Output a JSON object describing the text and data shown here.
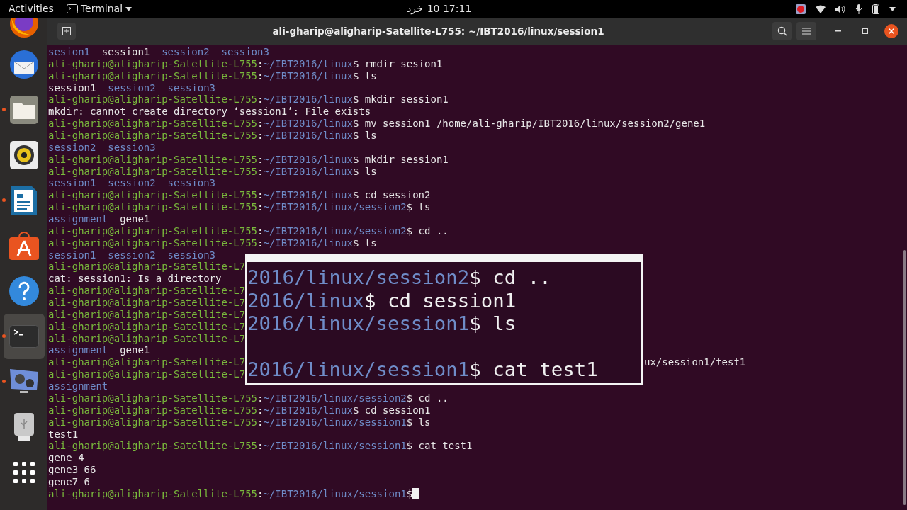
{
  "top_bar": {
    "activities": "Activities",
    "app_menu": "Terminal",
    "clock_label": "خرد",
    "clock_time": "10 17:11"
  },
  "dock": [
    {
      "kind": "firefox",
      "running": false,
      "selected": false
    },
    {
      "kind": "mail",
      "running": false,
      "selected": false
    },
    {
      "kind": "files",
      "running": true,
      "selected": false
    },
    {
      "kind": "music",
      "running": false,
      "selected": false
    },
    {
      "kind": "document",
      "running": true,
      "selected": false
    },
    {
      "kind": "store",
      "running": false,
      "selected": false
    },
    {
      "kind": "help",
      "running": false,
      "selected": false
    },
    {
      "kind": "terminal",
      "running": true,
      "selected": true
    },
    {
      "kind": "video",
      "running": true,
      "selected": false
    },
    {
      "kind": "usb",
      "running": false,
      "selected": false
    },
    {
      "kind": "apps",
      "running": false,
      "selected": false
    }
  ],
  "window": {
    "title": "ali-gharip@aligharip-Satellite-L755: ~/IBT2016/linux/session1"
  },
  "terminal": {
    "lines": [
      {
        "segments": [
          {
            "t": "sesion1",
            "kind": "dir"
          },
          {
            "t": "  session1  ",
            "kind": "plain"
          },
          {
            "t": "session2  ",
            "kind": "dir"
          },
          {
            "t": "session3",
            "kind": "dir"
          }
        ]
      },
      {
        "segments": [
          {
            "t": "ali-gharip@aligharip-Satellite-L755",
            "kind": "user"
          },
          {
            "t": ":",
            "kind": "plain"
          },
          {
            "t": "~/IBT2016/linux",
            "kind": "dir"
          },
          {
            "t": "$ rmdir sesion1",
            "kind": "plain"
          }
        ]
      },
      {
        "segments": [
          {
            "t": "ali-gharip@aligharip-Satellite-L755",
            "kind": "user"
          },
          {
            "t": ":",
            "kind": "plain"
          },
          {
            "t": "~/IBT2016/linux",
            "kind": "dir"
          },
          {
            "t": "$ ls",
            "kind": "plain"
          }
        ]
      },
      {
        "segments": [
          {
            "t": "session1  ",
            "kind": "plain"
          },
          {
            "t": "session2  ",
            "kind": "dir"
          },
          {
            "t": "session3",
            "kind": "dir"
          }
        ]
      },
      {
        "segments": [
          {
            "t": "ali-gharip@aligharip-Satellite-L755",
            "kind": "user"
          },
          {
            "t": ":",
            "kind": "plain"
          },
          {
            "t": "~/IBT2016/linux",
            "kind": "dir"
          },
          {
            "t": "$ mkdir session1",
            "kind": "plain"
          }
        ]
      },
      {
        "segments": [
          {
            "t": "mkdir: cannot create directory ‘session1’: File exists",
            "kind": "plain"
          }
        ]
      },
      {
        "segments": [
          {
            "t": "ali-gharip@aligharip-Satellite-L755",
            "kind": "user"
          },
          {
            "t": ":",
            "kind": "plain"
          },
          {
            "t": "~/IBT2016/linux",
            "kind": "dir"
          },
          {
            "t": "$ mv session1 /home/ali-gharip/IBT2016/linux/session2/gene1",
            "kind": "plain"
          }
        ]
      },
      {
        "segments": [
          {
            "t": "ali-gharip@aligharip-Satellite-L755",
            "kind": "user"
          },
          {
            "t": ":",
            "kind": "plain"
          },
          {
            "t": "~/IBT2016/linux",
            "kind": "dir"
          },
          {
            "t": "$ ls",
            "kind": "plain"
          }
        ]
      },
      {
        "segments": [
          {
            "t": "session2  ",
            "kind": "dir"
          },
          {
            "t": "session3",
            "kind": "dir"
          }
        ]
      },
      {
        "segments": [
          {
            "t": "ali-gharip@aligharip-Satellite-L755",
            "kind": "user"
          },
          {
            "t": ":",
            "kind": "plain"
          },
          {
            "t": "~/IBT2016/linux",
            "kind": "dir"
          },
          {
            "t": "$ mkdir session1",
            "kind": "plain"
          }
        ]
      },
      {
        "segments": [
          {
            "t": "ali-gharip@aligharip-Satellite-L755",
            "kind": "user"
          },
          {
            "t": ":",
            "kind": "plain"
          },
          {
            "t": "~/IBT2016/linux",
            "kind": "dir"
          },
          {
            "t": "$ ls",
            "kind": "plain"
          }
        ]
      },
      {
        "segments": [
          {
            "t": "session1  ",
            "kind": "dir"
          },
          {
            "t": "session2  ",
            "kind": "dir"
          },
          {
            "t": "session3",
            "kind": "dir"
          }
        ]
      },
      {
        "segments": [
          {
            "t": "ali-gharip@aligharip-Satellite-L755",
            "kind": "user"
          },
          {
            "t": ":",
            "kind": "plain"
          },
          {
            "t": "~/IBT2016/linux",
            "kind": "dir"
          },
          {
            "t": "$ cd session2",
            "kind": "plain"
          }
        ]
      },
      {
        "segments": [
          {
            "t": "ali-gharip@aligharip-Satellite-L755",
            "kind": "user"
          },
          {
            "t": ":",
            "kind": "plain"
          },
          {
            "t": "~/IBT2016/linux/session2",
            "kind": "dir"
          },
          {
            "t": "$ ls",
            "kind": "plain"
          }
        ]
      },
      {
        "segments": [
          {
            "t": "assignment",
            "kind": "dir"
          },
          {
            "t": "  gene1",
            "kind": "plain"
          }
        ]
      },
      {
        "segments": [
          {
            "t": "ali-gharip@aligharip-Satellite-L755",
            "kind": "user"
          },
          {
            "t": ":",
            "kind": "plain"
          },
          {
            "t": "~/IBT2016/linux/session2",
            "kind": "dir"
          },
          {
            "t": "$ cd ..",
            "kind": "plain"
          }
        ]
      },
      {
        "segments": [
          {
            "t": "ali-gharip@aligharip-Satellite-L755",
            "kind": "user"
          },
          {
            "t": ":",
            "kind": "plain"
          },
          {
            "t": "~/IBT2016/linux",
            "kind": "dir"
          },
          {
            "t": "$ ls",
            "kind": "plain"
          }
        ]
      },
      {
        "segments": [
          {
            "t": "session1  ",
            "kind": "dir"
          },
          {
            "t": "session2  ",
            "kind": "dir"
          },
          {
            "t": "session3",
            "kind": "dir"
          }
        ]
      },
      {
        "segments": [
          {
            "t": "ali-gharip@aligharip-Satellite-L7",
            "kind": "user"
          }
        ]
      },
      {
        "segments": [
          {
            "t": "cat: session1: Is a directory",
            "kind": "plain"
          }
        ]
      },
      {
        "segments": [
          {
            "t": "ali-gharip@aligharip-Satellite-L7",
            "kind": "user"
          }
        ]
      },
      {
        "segments": [
          {
            "t": "ali-gharip@aligharip-Satellite-L7",
            "kind": "user"
          }
        ]
      },
      {
        "segments": [
          {
            "t": "ali-gharip@aligharip-Satellite-L7",
            "kind": "user"
          }
        ]
      },
      {
        "segments": [
          {
            "t": "ali-gharip@aligharip-Satellite-L7",
            "kind": "user"
          }
        ]
      },
      {
        "segments": [
          {
            "t": "ali-gharip@aligharip-Satellite-L7",
            "kind": "user"
          }
        ]
      },
      {
        "segments": [
          {
            "t": "assignment",
            "kind": "dir"
          },
          {
            "t": "  gene1",
            "kind": "plain"
          }
        ]
      },
      {
        "segments": [
          {
            "t": "ali-gharip@aligharip-Satellite-L7",
            "kind": "user"
          }
        ],
        "right": "ux/session1/test1"
      },
      {
        "segments": [
          {
            "t": "ali-gharip@aligharip-Satellite-L7",
            "kind": "user"
          }
        ]
      },
      {
        "segments": [
          {
            "t": "assignment",
            "kind": "dir"
          }
        ]
      },
      {
        "segments": [
          {
            "t": "ali-gharip@aligharip-Satellite-L755",
            "kind": "user"
          },
          {
            "t": ":",
            "kind": "plain"
          },
          {
            "t": "~/IBT2016/linux/session2",
            "kind": "dir"
          },
          {
            "t": "$ cd ..",
            "kind": "plain"
          }
        ]
      },
      {
        "segments": [
          {
            "t": "ali-gharip@aligharip-Satellite-L755",
            "kind": "user"
          },
          {
            "t": ":",
            "kind": "plain"
          },
          {
            "t": "~/IBT2016/linux",
            "kind": "dir"
          },
          {
            "t": "$ cd session1",
            "kind": "plain"
          }
        ]
      },
      {
        "segments": [
          {
            "t": "ali-gharip@aligharip-Satellite-L755",
            "kind": "user"
          },
          {
            "t": ":",
            "kind": "plain"
          },
          {
            "t": "~/IBT2016/linux/session1",
            "kind": "dir"
          },
          {
            "t": "$ ls",
            "kind": "plain"
          }
        ]
      },
      {
        "segments": [
          {
            "t": "test1",
            "kind": "plain"
          }
        ]
      },
      {
        "segments": [
          {
            "t": "ali-gharip@aligharip-Satellite-L755",
            "kind": "user"
          },
          {
            "t": ":",
            "kind": "plain"
          },
          {
            "t": "~/IBT2016/linux/session1",
            "kind": "dir"
          },
          {
            "t": "$ cat test1",
            "kind": "plain"
          }
        ]
      },
      {
        "segments": [
          {
            "t": "gene 4",
            "kind": "plain"
          }
        ]
      },
      {
        "segments": [
          {
            "t": "gene3 66",
            "kind": "plain"
          }
        ]
      },
      {
        "segments": [
          {
            "t": "gene7 6",
            "kind": "plain"
          }
        ]
      },
      {
        "segments": [
          {
            "t": "ali-gharip@aligharip-Satellite-L755",
            "kind": "user"
          },
          {
            "t": ":",
            "kind": "plain"
          },
          {
            "t": "~/IBT2016/linux/session1",
            "kind": "dir"
          },
          {
            "t": "$",
            "kind": "plain"
          }
        ],
        "cursor": true
      }
    ]
  },
  "zoom_overlay": {
    "lines": [
      {
        "kind": "text",
        "path": "2016/linux/session2",
        "command": "$ cd .."
      },
      {
        "kind": "text",
        "path": "2016/linux",
        "command": "$ cd session1"
      },
      {
        "kind": "text",
        "path": "2016/linux/session1",
        "command": "$ ls"
      },
      {
        "kind": "blank"
      },
      {
        "kind": "text",
        "path": "2016/linux/session1",
        "command": "$ cat test1"
      }
    ]
  }
}
